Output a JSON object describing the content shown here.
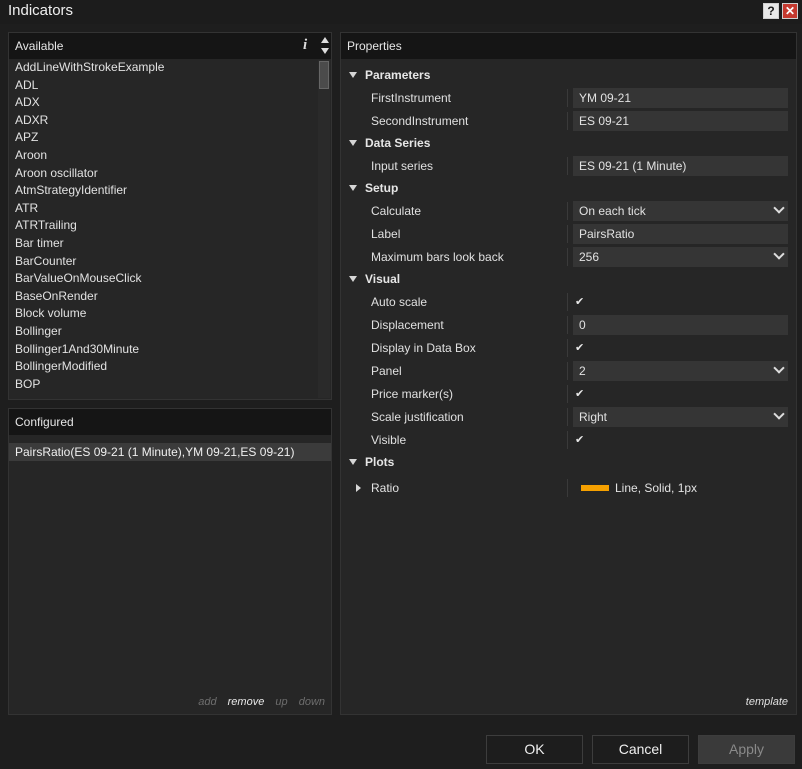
{
  "window": {
    "title": "Indicators"
  },
  "available": {
    "header": "Available",
    "items": [
      "AddLineWithStrokeExample",
      "ADL",
      "ADX",
      "ADXR",
      "APZ",
      "Aroon",
      "Aroon oscillator",
      "AtmStrategyIdentifier",
      "ATR",
      "ATRTrailing",
      "Bar timer",
      "BarCounter",
      "BarValueOnMouseClick",
      "BaseOnRender",
      "Block volume",
      "Bollinger",
      "Bollinger1And30Minute",
      "BollingerModified",
      "BOP"
    ]
  },
  "configured": {
    "header": "Configured",
    "items": [
      "PairsRatio(ES 09-21 (1 Minute),YM 09-21,ES 09-21)"
    ],
    "actions": {
      "add": "add",
      "remove": "remove",
      "up": "up",
      "down": "down"
    }
  },
  "properties": {
    "header": "Properties",
    "categories": [
      {
        "label": "Parameters",
        "rows": [
          {
            "name": "FirstInstrument",
            "value": "YM 09-21",
            "type": "text"
          },
          {
            "name": "SecondInstrument",
            "value": "ES 09-21",
            "type": "text"
          }
        ]
      },
      {
        "label": "Data Series",
        "rows": [
          {
            "name": "Input series",
            "value": "ES 09-21 (1 Minute)",
            "type": "text"
          }
        ]
      },
      {
        "label": "Setup",
        "rows": [
          {
            "name": "Calculate",
            "value": "On each tick",
            "type": "select"
          },
          {
            "name": "Label",
            "value": "PairsRatio",
            "type": "text"
          },
          {
            "name": "Maximum bars look back",
            "value": "256",
            "type": "select"
          }
        ]
      },
      {
        "label": "Visual",
        "rows": [
          {
            "name": "Auto scale",
            "value": true,
            "type": "check"
          },
          {
            "name": "Displacement",
            "value": "0",
            "type": "text"
          },
          {
            "name": "Display in Data Box",
            "value": true,
            "type": "check"
          },
          {
            "name": "Panel",
            "value": "2",
            "type": "select"
          },
          {
            "name": "Price marker(s)",
            "value": true,
            "type": "check"
          },
          {
            "name": "Scale justification",
            "value": "Right",
            "type": "select"
          },
          {
            "name": "Visible",
            "value": true,
            "type": "check"
          }
        ]
      },
      {
        "label": "Plots",
        "rows": []
      }
    ],
    "plot": {
      "name": "Ratio",
      "value": "Line, Solid, 1px",
      "color": "#f5a000"
    },
    "template_label": "template"
  },
  "buttons": {
    "ok": "OK",
    "cancel": "Cancel",
    "apply": "Apply"
  },
  "colors": {
    "background": "#1e1e1e",
    "panel": "#262626",
    "header": "#151515",
    "accent": "#f5a000",
    "close": "#c4392f"
  }
}
